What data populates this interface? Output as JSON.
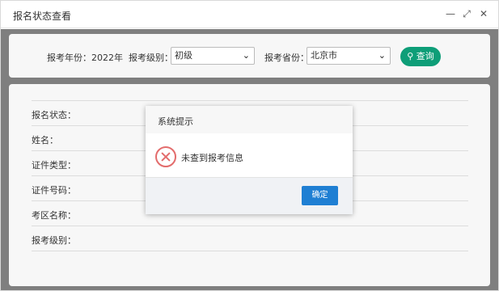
{
  "window": {
    "title": "报名状态查看"
  },
  "query": {
    "year_label": "报考年份：",
    "year_value": "2022年",
    "level_label": "报考级别：",
    "level_value": "初级",
    "province_label": "报考省份：",
    "province_value": "北京市",
    "search_button": "查询"
  },
  "info": {
    "fields": [
      "报名状态：",
      "姓名：",
      "证件类型：",
      "证件号码：",
      "考区名称：",
      "报考级别："
    ]
  },
  "dialog": {
    "title": "系统提示",
    "message": "未查到报考信息",
    "ok_button": "确定"
  }
}
